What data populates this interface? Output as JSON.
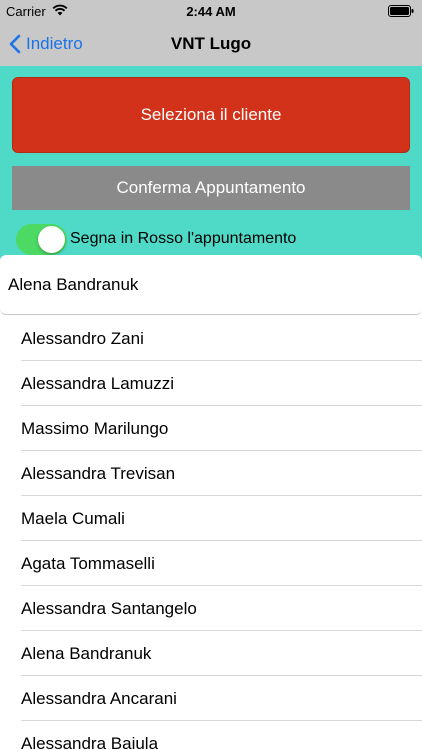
{
  "status_bar": {
    "carrier": "Carrier",
    "time": "2:44 AM",
    "wifi_icon": "wifi-icon",
    "battery_icon": "battery-icon"
  },
  "nav": {
    "back_label": "Indietro",
    "back_icon": "chevron-left-icon",
    "title": "VNT Lugo"
  },
  "actions": {
    "select_client_label": "Seleziona il cliente",
    "confirm_label": "Conferma Appuntamento",
    "toggle_label": "Segna in Rosso l'appuntamento",
    "toggle_on": true
  },
  "selected_client": "Alena Bandranuk",
  "clients": [
    "Alessandro Zani",
    "Alessandra Lamuzzi",
    "Massimo Marilungo",
    "Alessandra Trevisan",
    "Maela Cumali",
    "Agata Tommaselli",
    "Alessandra Santangelo",
    "Alena Bandranuk",
    "Alessandra Ancarani",
    "Alessandra Baiula"
  ],
  "colors": {
    "panel_teal": "#4fd9c7",
    "select_button_red": "#d2321a",
    "confirm_button_gray": "#8a8a8a",
    "toggle_green": "#4cd964",
    "nav_gray": "#c8c8c8",
    "link_blue": "#1a73e8"
  }
}
